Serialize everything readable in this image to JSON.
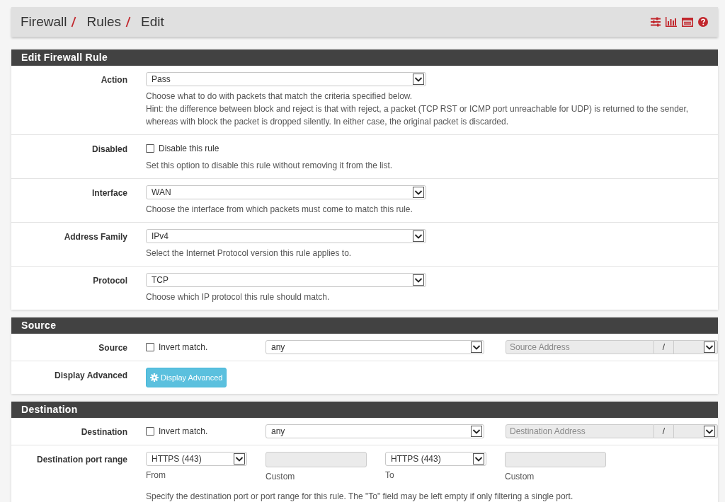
{
  "breadcrumb": [
    {
      "label": "Firewall"
    },
    {
      "label": "Rules"
    },
    {
      "label": "Edit"
    }
  ],
  "sections": [
    {
      "title": "Edit Firewall Rule",
      "rows": [
        {
          "kind": "select",
          "label": "Action",
          "value": "Pass",
          "help": [
            "Choose what to do with packets that match the criteria specified below.",
            "Hint: the difference between block and reject is that with reject, a packet (TCP RST or ICMP port unreachable for UDP) is returned to the sender, whereas with block the packet is dropped silently. In either case, the original packet is discarded."
          ]
        },
        {
          "kind": "checkbox",
          "label": "Disabled",
          "option": "Disable this rule",
          "checked": false,
          "help": [
            "Set this option to disable this rule without removing it from the list."
          ]
        },
        {
          "kind": "select",
          "label": "Interface",
          "value": "WAN",
          "help": [
            "Choose the interface from which packets must come to match this rule."
          ]
        },
        {
          "kind": "select",
          "label": "Address Family",
          "value": "IPv4",
          "help": [
            "Select the Internet Protocol version this rule applies to."
          ]
        },
        {
          "kind": "select",
          "label": "Protocol",
          "value": "TCP",
          "help": [
            "Choose which IP protocol this rule should match."
          ]
        }
      ]
    },
    {
      "title": "Source",
      "rows": [
        {
          "kind": "address",
          "label": "Source",
          "option": "Invert match.",
          "checked": false,
          "value": "any",
          "placeholder": "Source Address",
          "separator": "/"
        },
        {
          "kind": "button",
          "label": "Display Advanced",
          "button": "Display Advanced"
        }
      ]
    },
    {
      "title": "Destination",
      "rows": [
        {
          "kind": "address",
          "label": "Destination",
          "option": "Invert match.",
          "checked": false,
          "value": "any",
          "placeholder": "Destination Address",
          "separator": "/"
        },
        {
          "kind": "portrange",
          "label": "Destination port range",
          "from": "HTTPS (443)",
          "from_caption": "From",
          "custom_caption": "Custom",
          "to": "HTTPS (443)",
          "to_caption": "To",
          "custom_caption_2": "Custom",
          "help": [
            "Specify the destination port or port range for this rule. The \"To\" field may be left empty if only filtering a single port."
          ]
        }
      ]
    }
  ]
}
